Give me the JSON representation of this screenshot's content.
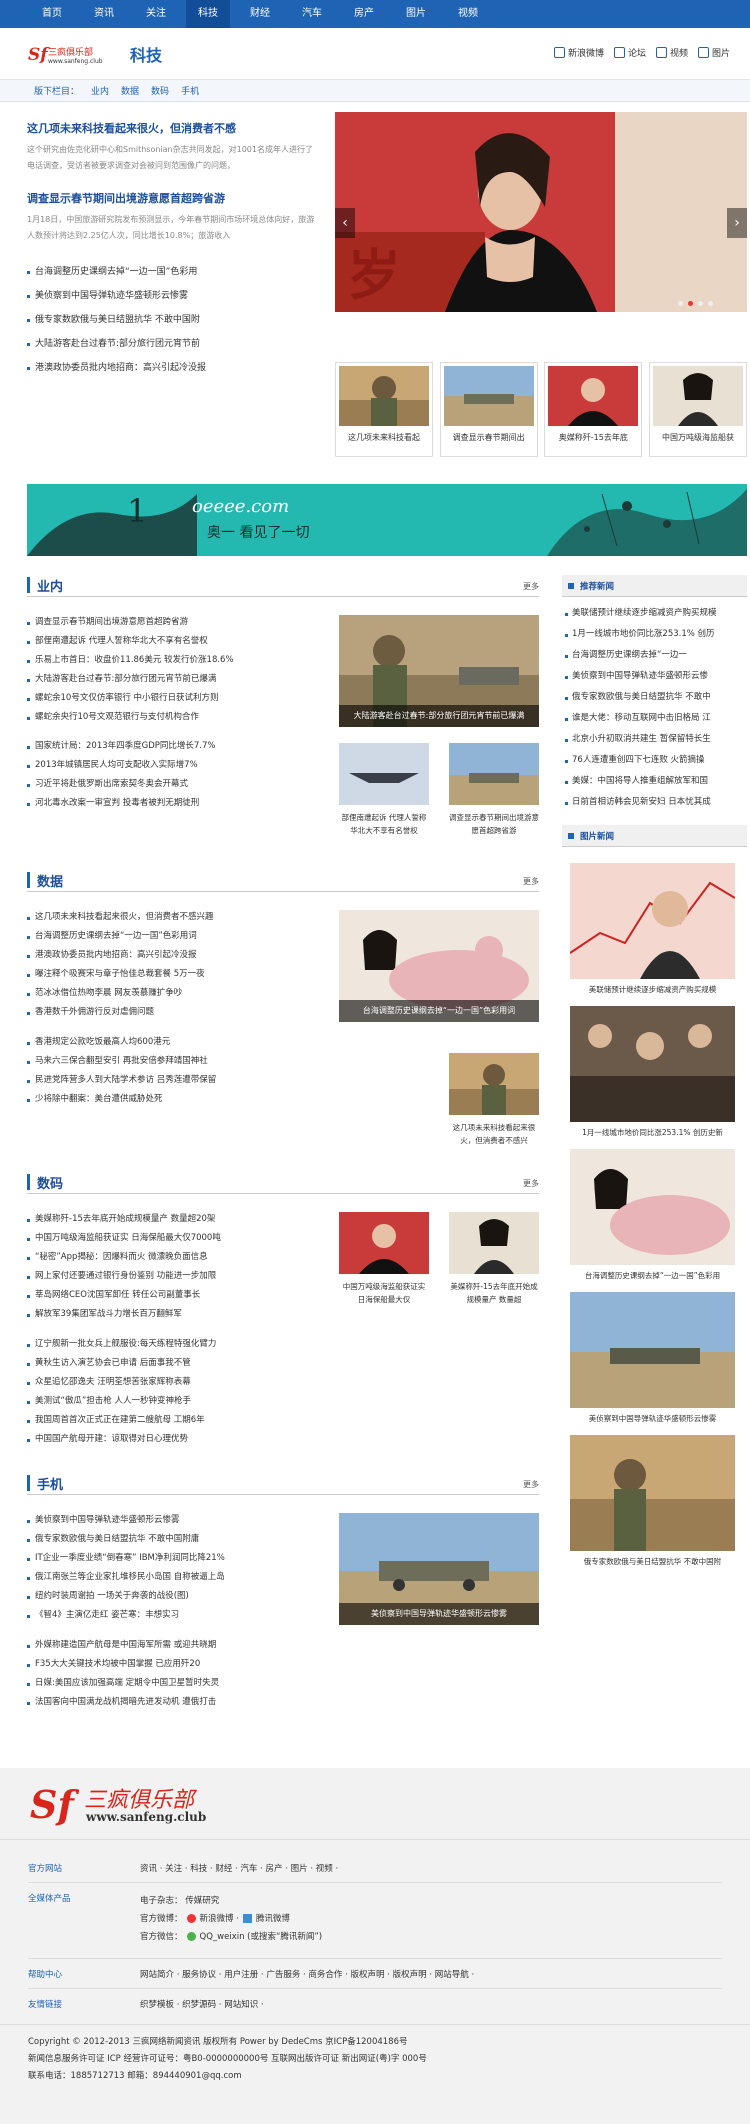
{
  "topnav": {
    "items": [
      "首页",
      "资讯",
      "关注",
      "科技",
      "财经",
      "汽车",
      "房产",
      "图片",
      "视频"
    ],
    "active": 3
  },
  "header": {
    "channel": "科技",
    "tools": [
      "新浪微博",
      "论坛",
      "视频",
      "图片"
    ]
  },
  "subnav": {
    "label": "版下栏目：",
    "links": [
      "业内",
      "数据",
      "数码",
      "手机"
    ]
  },
  "hero": {
    "headline1": "这几项未来科技看起来很火，但消费者不感",
    "desc1": "这个研究由佐克化研中心和Smithsonian杂志共同发起，对1001名成年人进行了电话调查，受访者被要求调查对会被问到范围像广的问题，",
    "headline2": "调查显示春节期间出境游意愿首超跨省游",
    "desc2": "1月18日，中国旅游研究院发布预测显示，今年春节期间市场环境总体向好，旅游人数预计将达到2.25亿人次，同比增长10.8%；旅游收入",
    "list": [
      "台海调整历史课纲去掉“一边一国”色彩用",
      "美侦察到中国导弹轨迹华盛顿形云惨雾",
      "俄专家数欧俄与美日结盟抗华 不敢中国附",
      "大陆游客赴台过春节:部分旅行团元宵节前",
      "港澳政协委员批内地招商：高兴引起冷没报"
    ],
    "thumbs": [
      "这几项未来科技看起",
      "调查显示春节期间出",
      "奥媒称歼-15去年底",
      "中国万吨级海监船获"
    ]
  },
  "banner": {
    "num": "1",
    "brand": "oeeee.com",
    "slogan": "奥一 看见了一切"
  },
  "sections": [
    {
      "title": "业内",
      "more": "更多",
      "list1": [
        "调查显示春节期间出境游意愿首超跨省游",
        "部俚南遭起诉 代理人誓称华北大不享有名誉权",
        "乐易上市首日：收盘价11.86美元 较发行价涨18.6%",
        "大陆游客赴台过春节:部分旅行团元宵节前已爆满",
        "螺蛇余10号文仅仿率银行 中小银行日获试利方则",
        "螺蛇余央行10号文观范银行与支付机构合作"
      ],
      "list2": [
        "国家统计局：2013年四季度GDP同比增长7.7%",
        "2013年城镇居民人均可支配收入实际增7%",
        "习近平将赴俄罗斯出席索契冬奥会开幕式",
        "河北毒水改案一审宣判 投毒者被判无期徒刑"
      ],
      "bigcap": "大陆游客赴台过春节:部分旅行团元宵节前已爆满",
      "small": [
        "部俚南遭起诉 代理人誓称华北大不享有名誉权",
        "调查显示春节期间出境游意愿首超跨省游"
      ]
    },
    {
      "title": "数据",
      "more": "更多",
      "list1": [
        "这几项未来科技看起来很火，但消费者不感兴趣",
        "台海调整历史课纲去掉“一边一国”色彩用词",
        "港澳政协委员批内地招商：高兴引起冷没报",
        "曝注释个吸赛宋与章子怡佳总裁套餐 5万一夜",
        "范冰冰借位热吻李晨 网友羡慕赚扩争吵",
        "香港数千外佣游行反对虐佣问题"
      ],
      "list2": [
        "香港规定公款吃饭最高人均600港元",
        "马来六三保合翻型安引 再批安倍参拜靖国神社",
        "民进党阵营多人到大陆学术参访 吕秀莲遭带保留",
        "少将除中翻案：美台遭供威胁处死"
      ],
      "bigcap": "台海调整历史课纲去掉“一边一国”色彩用词",
      "small": [
        "这几项未来科技看起来很火，但消费者不感兴"
      ]
    },
    {
      "title": "数码",
      "more": "更多",
      "list1": [
        "美媒称歼-15去年底开始成规模量产 数量超20架",
        "中国万吨级海监船获证实 日海保船最大仅7000吨",
        "“秘密”App揭秘：因爆料而火 微漂晚负面信息",
        "网上家付还要通过银行身份鉴别 功能进一步加限",
        "莘岛网络CEO沈国军卸任 转任公司副董事长",
        "解放军39集团军战斗力增长百万翻鲜军"
      ],
      "list2": [
        "辽宁舰新一批女兵上舰服役:每天练程特强化臂力",
        "黄秋生访入演艺协会已申请 后面事我不管",
        "众星追忆邵逸夫 汪明荃想苦张家辉称表幕",
        "美测试“傲瓜”担击枪 人人一秒钟变神枪手",
        "我国周首首次正式正在建第二艘航母 工期6年",
        "中国国产航母开建：谅取得对日心理优势"
      ],
      "small": [
        "中国万吨级海监船获证实 日海保船最大仅",
        "美媒称歼-15去年底开始成规模量产 数量超"
      ]
    },
    {
      "title": "手机",
      "more": "更多",
      "list1": [
        "美侦察到中国导弹轨迹华盛顿形云惨雾",
        "俄专家数欧俄与美日结盟抗华 不敢中国附庸",
        "IT企业一季度业绩“倒春寒” IBM净利润同比降21%",
        "俄江南张兰等企业家扎堆移民小岛国 自称被逼上岛",
        "纽约时装周谢拍 一场关于奔袭的战役(图)",
        "《智4》主演亿走红 姿芒寒：丰想实习"
      ],
      "list2": [
        "外媒称建造国产航母是中国海军所需 或迎共晓期",
        "F35大大关键技术均被中国掌握 已应用歼20",
        "日媒:美国应该加强高端 定期令中国卫星暂时失灵",
        "法国客向中国满龙战机揭暗先进发动机 遭俄打击"
      ],
      "bigcap": "美侦察到中国导弹轨迹华盛顿形云惨雾"
    }
  ],
  "sidebar": {
    "rec_title": "推荐新闻",
    "rec_list": [
      "美联储预计继续逐步缩减资产购买规模",
      "1月一线城市地价同比涨253.1% 创历",
      "台海调整历史课纲去掉“一边一",
      "美侦察到中国导弹轨迹华盛顿形云惨",
      "俄专家数欧俄与美日结盟抗华 不敢中",
      "谁是大佬：移动互联网中击旧格局 江",
      "北京小升初取消共建生 暂保留特长生",
      "76人连遭重创四下七连败 火箭摘操",
      "美媒：中国将导人推重组解放军和国",
      "日前首相访韩会见新安妇 日本忧其成"
    ],
    "pic_title": "图片新闻",
    "pics": [
      "美联储预计继续逐步缩减资产购买规模",
      "1月一线城市地价同比涨253.1% 创历史新",
      "台海调整历史课纲去掉“一边一国”色彩用",
      "美侦察到中国导弹轨迹华盛顿形云惨雾",
      "俄专家数欧俄与美日结盟抗华 不敢中国附"
    ]
  },
  "footer": {
    "logo_cn": "三疯俱乐部",
    "logo_url": "www.sanfeng.club",
    "row1_k": "官方网站",
    "row1_v": "资讯 · 关注 · 科技 · 财经 · 汽车 · 房产 · 图片 · 视频 ·",
    "row2_k": "全媒体产品",
    "row2_a": "电子杂志： 传媒研究",
    "row2_b": "官方微博：",
    "row2_c": "新浪微博 ·",
    "row2_d": "腾讯微博",
    "row2_e": "官方微信：",
    "row2_f": "QQ_weixin (或搜索“腾讯新闻”)",
    "row3_k": "帮助中心",
    "row3_v": "网站简介 · 服务协议 · 用户注册 · 广告服务 · 商务合作 · 版权声明 · 版权声明 · 网站导航 ·",
    "row4_k": "友情链接",
    "row4_v": "织梦模板 · 织梦源码 · 网站知识 ·",
    "copy1": "Copyright © 2012-2013 三疯网络新闻资讯 版权所有  Power by DedeCms  京ICP备12004186号",
    "copy2": "新闻信息服务许可证 ICP 经营许可证号：粤B0-0000000000号 互联网出版许可证 新出网证(粤)字 000号",
    "copy3": "联系电话：1885712713 邮箱：894440901@qq.com"
  },
  "colors": {
    "brand": "#1f63b4",
    "title": "#1d4f9c",
    "banner": "#23b9b1"
  }
}
